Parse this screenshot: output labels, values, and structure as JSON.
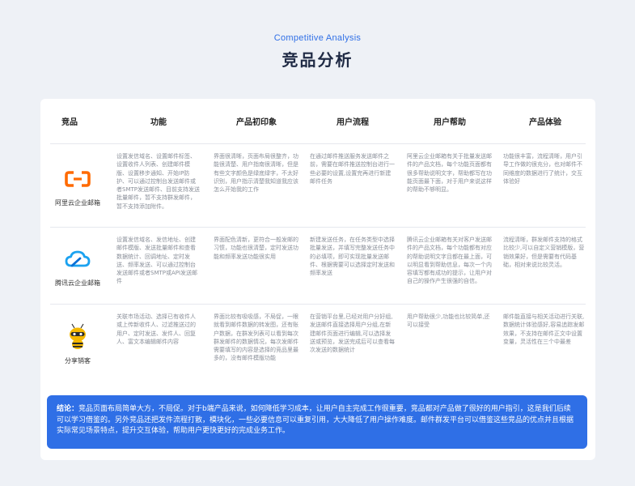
{
  "header": {
    "subtitle": "Competitive Analysis",
    "title": "竞品分析"
  },
  "table": {
    "columns": [
      "竞品",
      "功能",
      "产品初印象",
      "用户流程",
      "用户帮助",
      "产品体验"
    ],
    "rows": [
      {
        "product": "阿里云企业邮箱",
        "logo_icon": "aliyun-logo-icon",
        "logo_color": "#ff6a00",
        "function": "设置发信域名、设置邮件标签、设置收件人列表、创建邮件模版、设置移步通知、开始IP防护、可以通过控制台发送邮件或者SMTP发送邮件、目前支持发送批量邮件，暂不支持群发邮件，暂不支持添加附件。",
        "impression": "界面很清晰，页面布局很整齐，功能很清楚、用户指南很清晰，但是有些文字颜色是绿底绿字，不太好识别，用户指示清楚我知道我应该怎么开始我的工作",
        "flow": "在通过邮件推送服务发送邮件之前，需要在邮件推送控制台进行一些必要的设置,设置完再进行新建邮件任务",
        "help": "阿里云企业邮箱有关于批量发送邮件的产品文档，每个功能页面都有很多帮助说明文字，帮助都写在功能页面最下面，对于用户来说这样的帮助不够明显。",
        "experience": "功能很丰富，流程清晰，用户引导工作做的很充分，也对邮件不同维度的数据进行了统计，交互体验好"
      },
      {
        "product": "腾讯云企业邮箱",
        "logo_icon": "tencent-cloud-logo-icon",
        "logo_color": "#1ba2f0",
        "function": "设置发信域名、发信地址、创建邮件模版、发送批量邮件和查看数据统计、回调地址、定时发送、频率发送、可以通过控制台发送邮件或者SMTP或API发送邮件",
        "impression": "界面配色清新，更符合一般发邮的习惯，功能也很清楚，定时发送功能和频率发送功能很实用",
        "flow": "新建发送任务，在任务类型中选择批量发送，并填写完整发送任务中的必填项，即可实现批量发送邮件、根据需要可以选择定时发送和频率发送",
        "help": "腾讯云企业邮箱有关对客户发送邮件的产品文档，每个功能都有对应的帮助说明文字且都在最上面，可以明显看到帮助信息，每次一个内容填写都有成功的提示，让用户对自己的操作产生很强的自信。",
        "experience": "流程清晰，群发邮件支持的格式比较少,可以自定义营销模版，营销效果好，但是需要有代码基础，相对来说比较灵活。"
      },
      {
        "product": "分享销客",
        "logo_icon": "fenxiang-bee-logo-icon",
        "logo_color": "#f5b800",
        "function": "关联市场活动、选择已有收件人或上传新收件人、过滤推送过的用户、定时发送、发件人、回复人、富文本编辑邮件内容",
        "impression": "界面比较有吸吸感，不局促，一眼就看到邮件数据的转发图，还有账户数据，在群发列表可以看到每次群发邮件的数据情况，每次发邮件需要填写的内容是选择的竞品里最多的，没有邮件模版功能",
        "flow": "在营销平台里,已经对用户分好组,发送邮件直接选择用户分组,在新建邮件页面进行编辑,可以选择发送或预览，发送完成后可以查看每次发送的数据统计",
        "help": "用户帮助很少,功能也比较简单,还可以接受",
        "experience": "邮件能直接与相关活动进行关联,数据统计体验感好,容易追踪发邮效果，不支持在邮件正文中设置变量，灵活性在三个中最差"
      }
    ]
  },
  "conclusion": {
    "label": "结论：",
    "text": "竞品页面布局简单大方，不局促。对于b端产品来说，如何降低学习成本，让用户自主完成工作很重要，竞品都对产品做了很好的用户指引，这是我们后续可以学习借鉴的。另外竞品还把发件流程打散，模块化，一些必要信息可以重复引用，大大降低了用户操作难度。邮件群发平台可以借鉴这些竞品的优点并且根据实际常见场景特点，提升交互体验，帮助用户更快更好的完成业务工作。"
  }
}
